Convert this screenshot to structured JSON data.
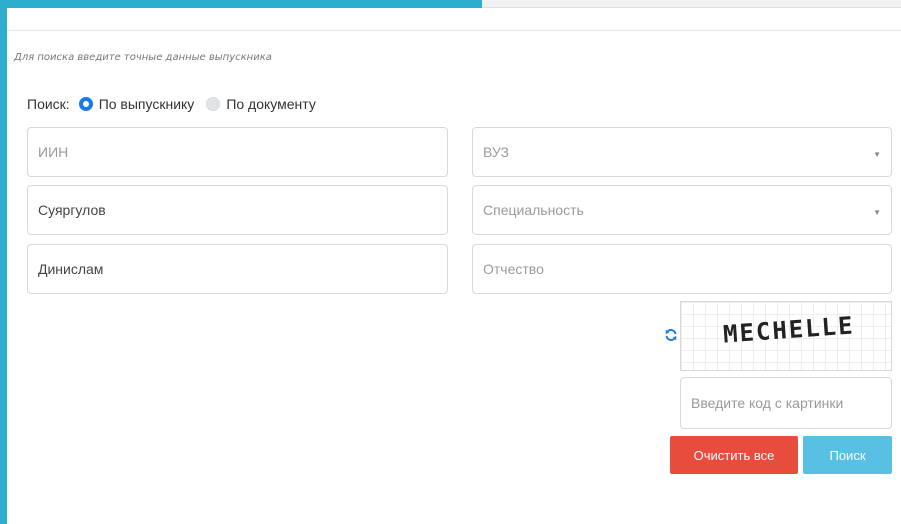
{
  "hint": "Для поиска введите точные данные выпускника",
  "search_mode": {
    "label": "Поиск:",
    "options": [
      {
        "label": "По выпускнику",
        "selected": true
      },
      {
        "label": "По документу",
        "selected": false
      }
    ]
  },
  "fields": {
    "iin": {
      "value": "",
      "placeholder": "ИИН"
    },
    "last_name": {
      "value": "Суяргулов",
      "placeholder": ""
    },
    "first_name": {
      "value": "Динислам",
      "placeholder": ""
    },
    "university": {
      "value": "",
      "placeholder": "ВУЗ"
    },
    "specialty": {
      "value": "",
      "placeholder": "Специальность"
    },
    "patronymic": {
      "value": "",
      "placeholder": "Отчество"
    }
  },
  "captcha": {
    "code": "MECHELLE",
    "input_placeholder": "Введите код с картинки",
    "refresh_icon": "refresh-icon"
  },
  "buttons": {
    "clear": "Очистить все",
    "search": "Поиск"
  },
  "colors": {
    "accent": "#2eaecf",
    "radio_selected": "#1a7ae6",
    "danger": "#e84c3d",
    "info": "#57c0e3"
  }
}
